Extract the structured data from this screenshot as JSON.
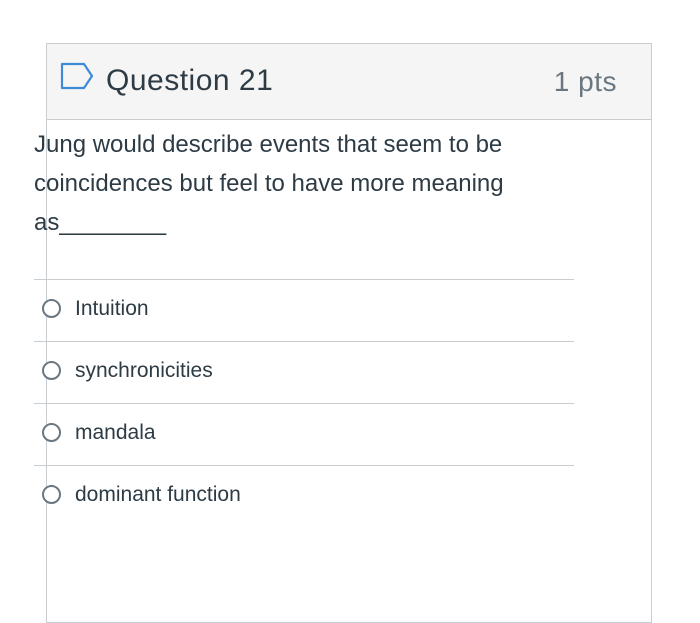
{
  "question": {
    "title": "Question 21",
    "points": "1 pts",
    "text": "Jung would describe events that seem to be coincidences but feel to have more meaning as________",
    "flag_icon": "flag-outline-icon"
  },
  "answers": [
    {
      "label": "Intuition"
    },
    {
      "label": "synchronicities"
    },
    {
      "label": "mandala"
    },
    {
      "label": "dominant function"
    }
  ],
  "colors": {
    "text": "#2d3b45",
    "muted": "#6b7780",
    "border": "#c7cdd1",
    "header_bg": "#f5f5f5",
    "flag": "#3e8ad8"
  }
}
